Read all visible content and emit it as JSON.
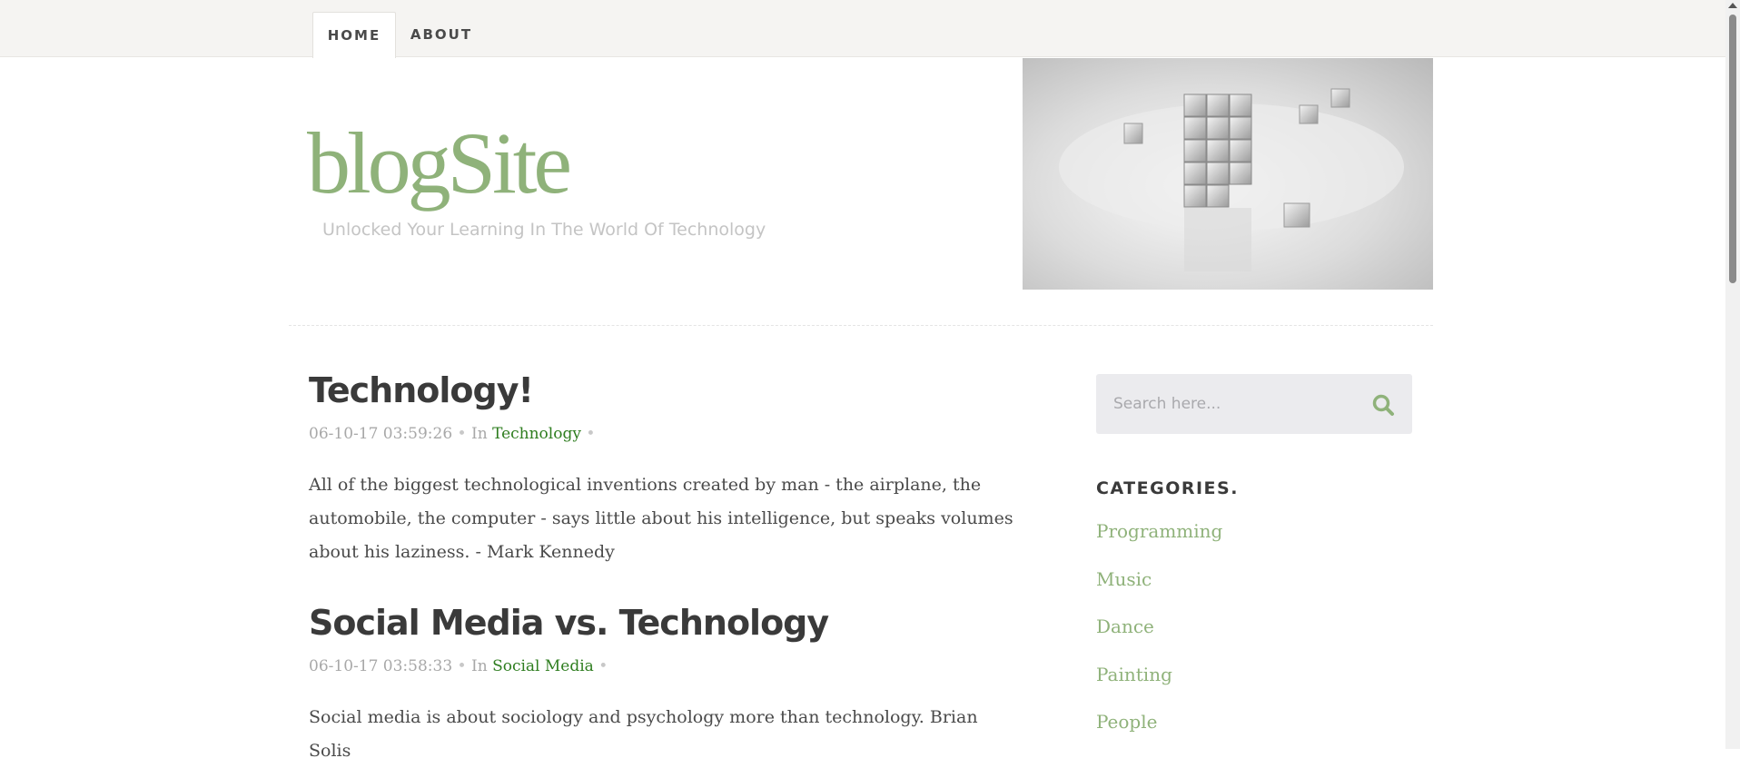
{
  "nav": {
    "tabs": [
      {
        "label": "HOME",
        "active": true
      },
      {
        "label": "ABOUT",
        "active": false
      }
    ]
  },
  "header": {
    "logo": "blogSite",
    "tagline": "Unlocked Your Learning In The World Of Technology",
    "hero_image": "ice-cubes-tower-image"
  },
  "posts": [
    {
      "title": "Technology!",
      "date": "06-10-17 03:59:26",
      "in_label": "In",
      "category": "Technology",
      "body": "All of the biggest technological inventions created by man - the airplane, the automobile, the computer - says little about his intelligence, but speaks volumes about his laziness. - Mark Kennedy"
    },
    {
      "title": "Social Media vs. Technology",
      "date": "06-10-17 03:58:33",
      "in_label": "In",
      "category": "Social Media",
      "body": "Social media is about sociology and psychology more than technology. Brian Solis"
    }
  ],
  "sidebar": {
    "search": {
      "placeholder": "Search here...",
      "value": ""
    },
    "categories_heading": "CATEGORIES.",
    "categories": [
      "Programming",
      "Music",
      "Dance",
      "Painting",
      "People"
    ]
  },
  "colors": {
    "accent": "#8fb27a",
    "link": "#2e7d1f",
    "nav_bg": "#f5f4f2"
  }
}
